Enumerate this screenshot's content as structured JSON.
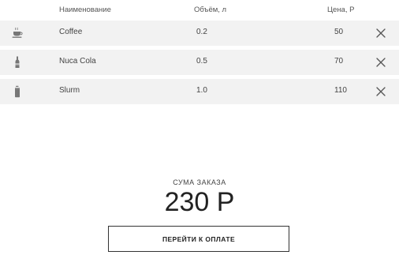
{
  "columns": {
    "name": "Наименование",
    "volume": "Объём, л",
    "price": "Цена, Р"
  },
  "items": [
    {
      "icon": "coffee-cup-icon",
      "name": "Coffee",
      "volume": "0.2",
      "price": "50"
    },
    {
      "icon": "soda-bottle-icon",
      "name": "Nuca Cola",
      "volume": "0.5",
      "price": "70"
    },
    {
      "icon": "soda-can-icon",
      "name": "Slurm",
      "volume": "1.0",
      "price": "110"
    }
  ],
  "summary": {
    "label": "СУМА ЗАКАЗА",
    "total": "230 Р"
  },
  "checkout": {
    "label": "ПЕРЕЙТИ К ОПЛАТЕ"
  },
  "colors": {
    "row_background": "#f2f2f2",
    "text": "#333333",
    "icon": "#777777"
  }
}
